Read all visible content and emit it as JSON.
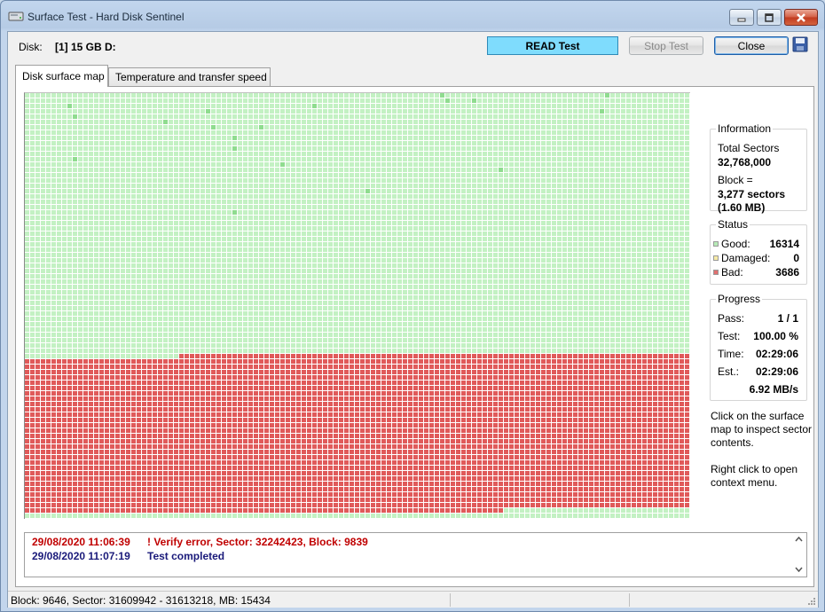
{
  "window": {
    "title": "Surface Test - Hard Disk Sentinel"
  },
  "header": {
    "disk_label": "Disk:",
    "disk_value": "[1] 15 GB D:",
    "mode_label": "READ Test",
    "stop_label": "Stop Test",
    "close_label": "Close"
  },
  "tabs": [
    {
      "label": "Disk surface map",
      "active": true
    },
    {
      "label": "Temperature and transfer speed",
      "active": false
    }
  ],
  "surface_map": {
    "columns": 125,
    "rows": 80,
    "total_blocks": 10000,
    "good_color": "#c3f1c3",
    "good_dark_color": "#8fdc8f",
    "bad_color": "#e05a5a",
    "grid_color": "#ffffff"
  },
  "information": {
    "title": "Information",
    "total_sectors_label": "Total Sectors",
    "total_sectors_value": "32,768,000",
    "block_label": "Block =",
    "block_sectors": "3,277 sectors",
    "block_size": "(1.60 MB)"
  },
  "status": {
    "title": "Status",
    "good_label": "Good:",
    "good_value": "16314",
    "damaged_label": "Damaged:",
    "damaged_value": "0",
    "bad_label": "Bad:",
    "bad_value": "3686",
    "good_color": "#b6eab6",
    "damaged_color": "#f6eaa6",
    "bad_color": "#e07070"
  },
  "progress": {
    "title": "Progress",
    "pass_label": "Pass:",
    "pass_value": "1 / 1",
    "test_label": "Test:",
    "test_value": "100.00 %",
    "time_label": "Time:",
    "time_value": "02:29:06",
    "est_label": "Est.:",
    "est_value": "02:29:06",
    "speed_value": "6.92 MB/s"
  },
  "hints": {
    "inspect": "Click on the surface map to inspect sector contents.",
    "context": "Right click to open context menu."
  },
  "log": [
    {
      "timestamp": "29/08/2020  11:06:39",
      "message": "! Verify error, Sector: 32242423, Block: 9839",
      "kind": "error"
    },
    {
      "timestamp": "29/08/2020  11:07:19",
      "message": "Test completed",
      "kind": "info"
    }
  ],
  "statusbar": {
    "text": "Block: 9646, Sector: 31609942 - 31613218, MB: 15434"
  }
}
